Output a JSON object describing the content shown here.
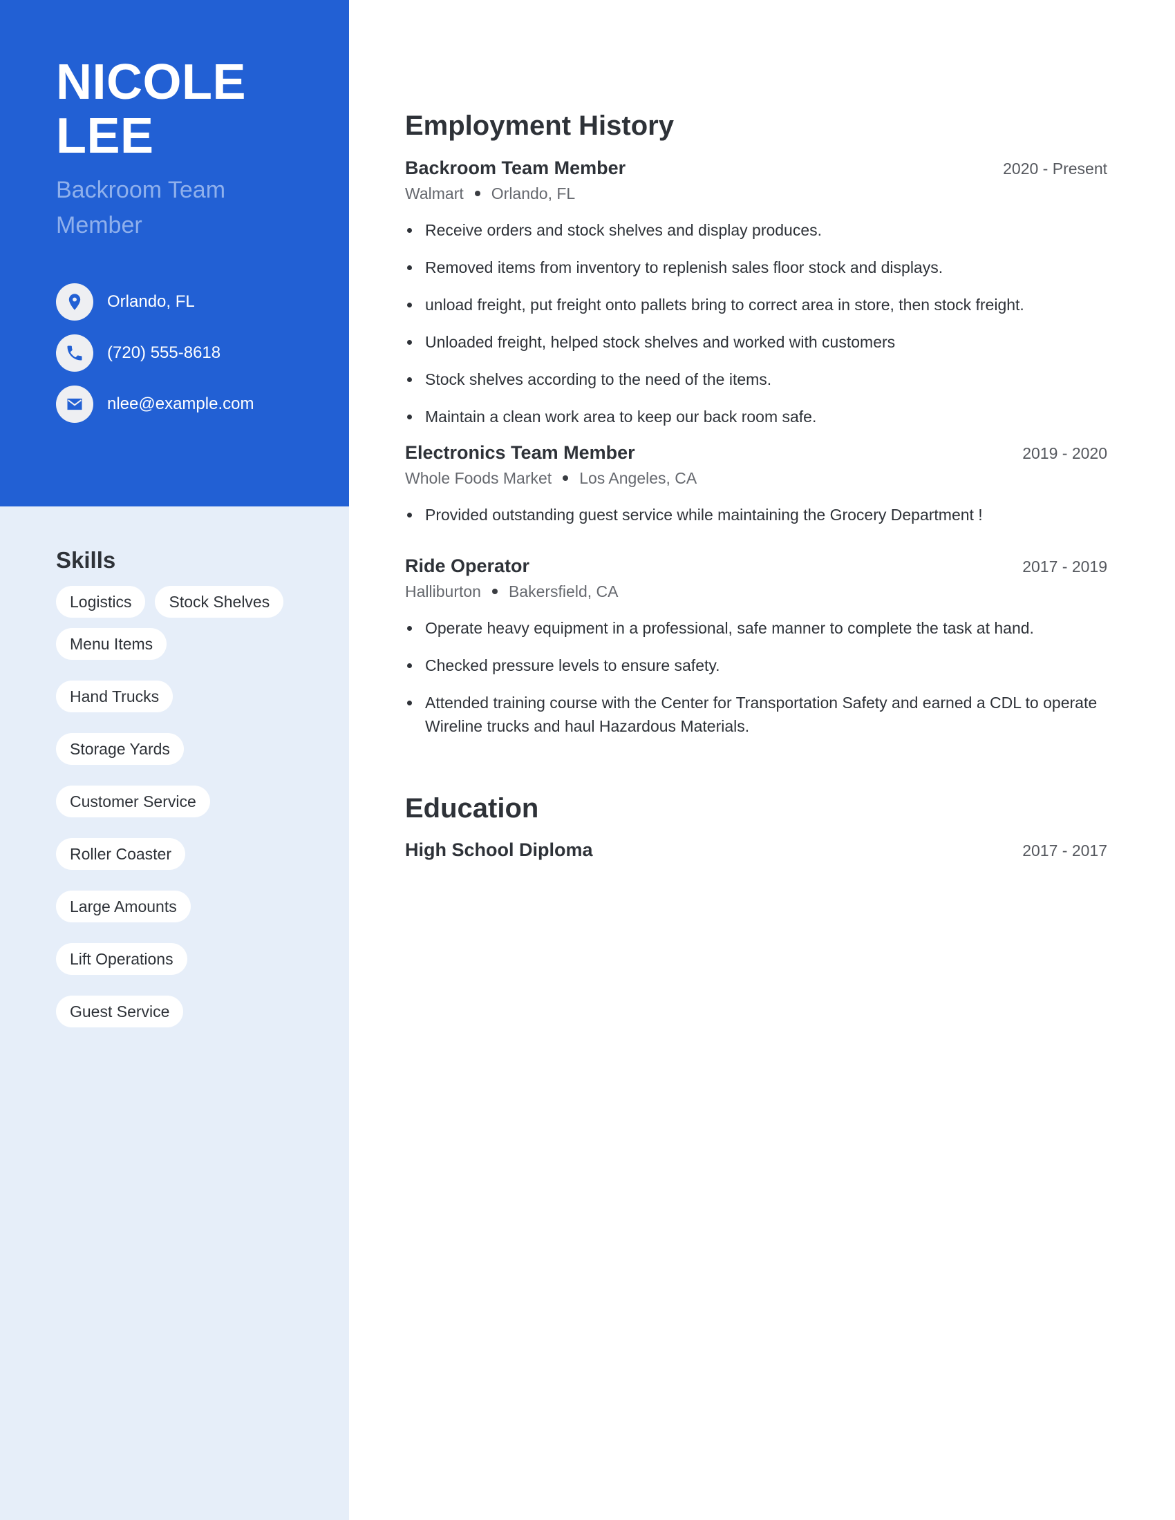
{
  "header": {
    "name_line1": "NICOLE",
    "name_line2": "LEE",
    "job_title": "Backroom Team Member"
  },
  "contact": [
    {
      "icon": "location-pin-icon",
      "text": "Orlando, FL"
    },
    {
      "icon": "phone-icon",
      "text": "(720) 555-8618"
    },
    {
      "icon": "email-icon",
      "text": "nlee@example.com"
    }
  ],
  "skills": {
    "heading": "Skills",
    "items": [
      "Logistics",
      "Stock Shelves",
      "Menu Items",
      "Hand Trucks",
      "Storage Yards",
      "Customer Service",
      "Roller Coaster",
      "Large Amounts",
      "Lift Operations",
      "Guest Service"
    ]
  },
  "employment": {
    "heading": "Employment History",
    "jobs": [
      {
        "title": "Backroom Team Member",
        "dates": "2020 - Present",
        "company": "Walmart",
        "location": "Orlando, FL",
        "bullets": [
          "Receive orders and stock shelves and display produces.",
          "Removed items from inventory to replenish sales floor stock and displays.",
          "unload freight, put freight onto pallets bring to correct area in store, then stock freight.",
          "Unloaded freight, helped stock shelves and worked with customers",
          "Stock shelves according to the need of the items.",
          "Maintain a clean work area to keep our back room safe."
        ]
      },
      {
        "title": "Electronics Team Member",
        "dates": "2019 - 2020",
        "company": "Whole Foods Market",
        "location": "Los Angeles, CA",
        "bullets": [
          "Provided outstanding guest service while maintaining the Grocery Department !"
        ]
      },
      {
        "title": "Ride Operator",
        "dates": "2017 - 2019",
        "company": "Halliburton",
        "location": "Bakersfield, CA",
        "bullets": [
          "Operate heavy equipment in a professional, safe manner to complete the task at hand.",
          "Checked pressure levels to ensure safety.",
          "Attended training course with the Center for Transportation Safety and earned a CDL to operate Wireline trucks and haul Hazardous Materials."
        ]
      }
    ]
  },
  "education": {
    "heading": "Education",
    "items": [
      {
        "degree": "High School Diploma",
        "dates": "2017 - 2017"
      }
    ]
  },
  "colors": {
    "accent": "#2260d4",
    "sidebar_bg": "#e6eef9",
    "title_light": "#8fb0ec",
    "text": "#2e3238"
  }
}
